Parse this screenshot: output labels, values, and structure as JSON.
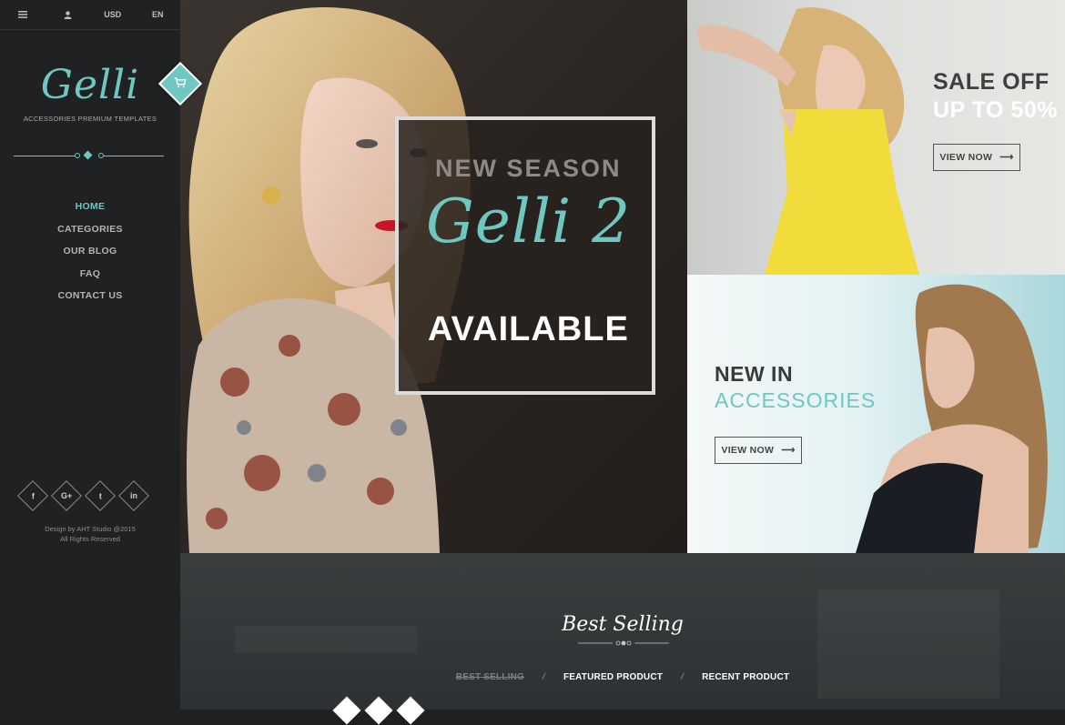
{
  "topbar": {
    "menu_icon": "hamburger-icon",
    "user_icon": "user-icon",
    "currency": "USD",
    "language": "EN"
  },
  "brand": {
    "logo": "Gelli",
    "tagline": "ACCESSORIES PREMIUM TEMPLATES"
  },
  "nav": {
    "items": [
      {
        "label": "HOME",
        "active": true
      },
      {
        "label": "CATEGORIES"
      },
      {
        "label": "OUR BLOG"
      },
      {
        "label": "FAQ"
      },
      {
        "label": "CONTACT US"
      }
    ]
  },
  "social": [
    {
      "icon": "facebook-icon",
      "glyph": "f"
    },
    {
      "icon": "google-plus-icon",
      "glyph": "G+"
    },
    {
      "icon": "twitter-icon",
      "glyph": "t"
    },
    {
      "icon": "linkedin-icon",
      "glyph": "in"
    }
  ],
  "credits": {
    "line1": "Design by AHT Studio @2015",
    "line2": "All Rights Reserved"
  },
  "hero": {
    "kicker": "NEW SEASON",
    "script": "Gelli 2",
    "headline": "AVAILABLE"
  },
  "promo1": {
    "title": "SALE OFF",
    "subtitle": "UP TO 50%",
    "button": "VIEW NOW"
  },
  "promo2": {
    "title": "NEW IN",
    "subtitle": "ACCESSORIES",
    "button": "VIEW NOW"
  },
  "best_selling": {
    "title": "Best Selling",
    "tabs": [
      "BEST SELLING",
      "FEATURED PRODUCT",
      "RECENT PRODUCT"
    ]
  },
  "colors": {
    "accent": "#6fc7c1",
    "sidebar": "#202122"
  }
}
